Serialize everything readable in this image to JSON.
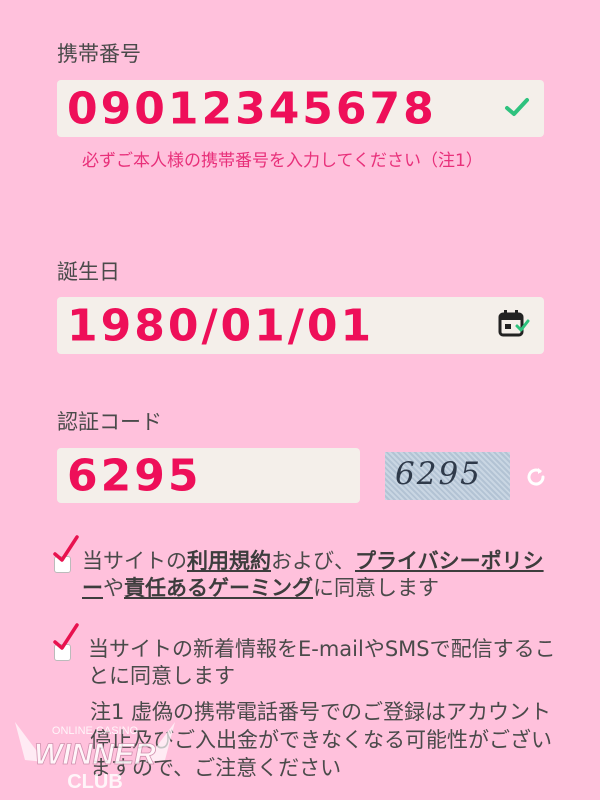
{
  "phone": {
    "label": "携帯番号",
    "value": "09012345678",
    "hint": "必ずご本人様の携帯番号を入力してください（注1）"
  },
  "birthday": {
    "label": "誕生日",
    "value": "1980/01/01"
  },
  "code": {
    "label": "認証コード",
    "value": "6295",
    "captcha": "6295"
  },
  "agree_terms": {
    "prefix": "当サイトの",
    "link_terms": "利用規約",
    "mid1": "および、",
    "link_privacy": "プライバシーポリシー",
    "mid2": "や",
    "link_responsible": "責任あるゲーミング",
    "suffix": "に同意します"
  },
  "agree_news": {
    "text": "当サイトの新着情報をE-mailやSMSで配信することに同意します"
  },
  "note": {
    "text": "注1 虚偽の携帯電話番号でのご登録はアカウント停止及びご入出金ができなくなる可能性がございますので、ご注意ください"
  },
  "logo": {
    "line1": "ONLINE CASINO",
    "line2": "WINNER",
    "line3": "CLUB"
  },
  "colors": {
    "background": "#ffc1dc",
    "accent": "#ee0f59",
    "valid": "#2ec27e",
    "field_bg": "#f4efea"
  }
}
